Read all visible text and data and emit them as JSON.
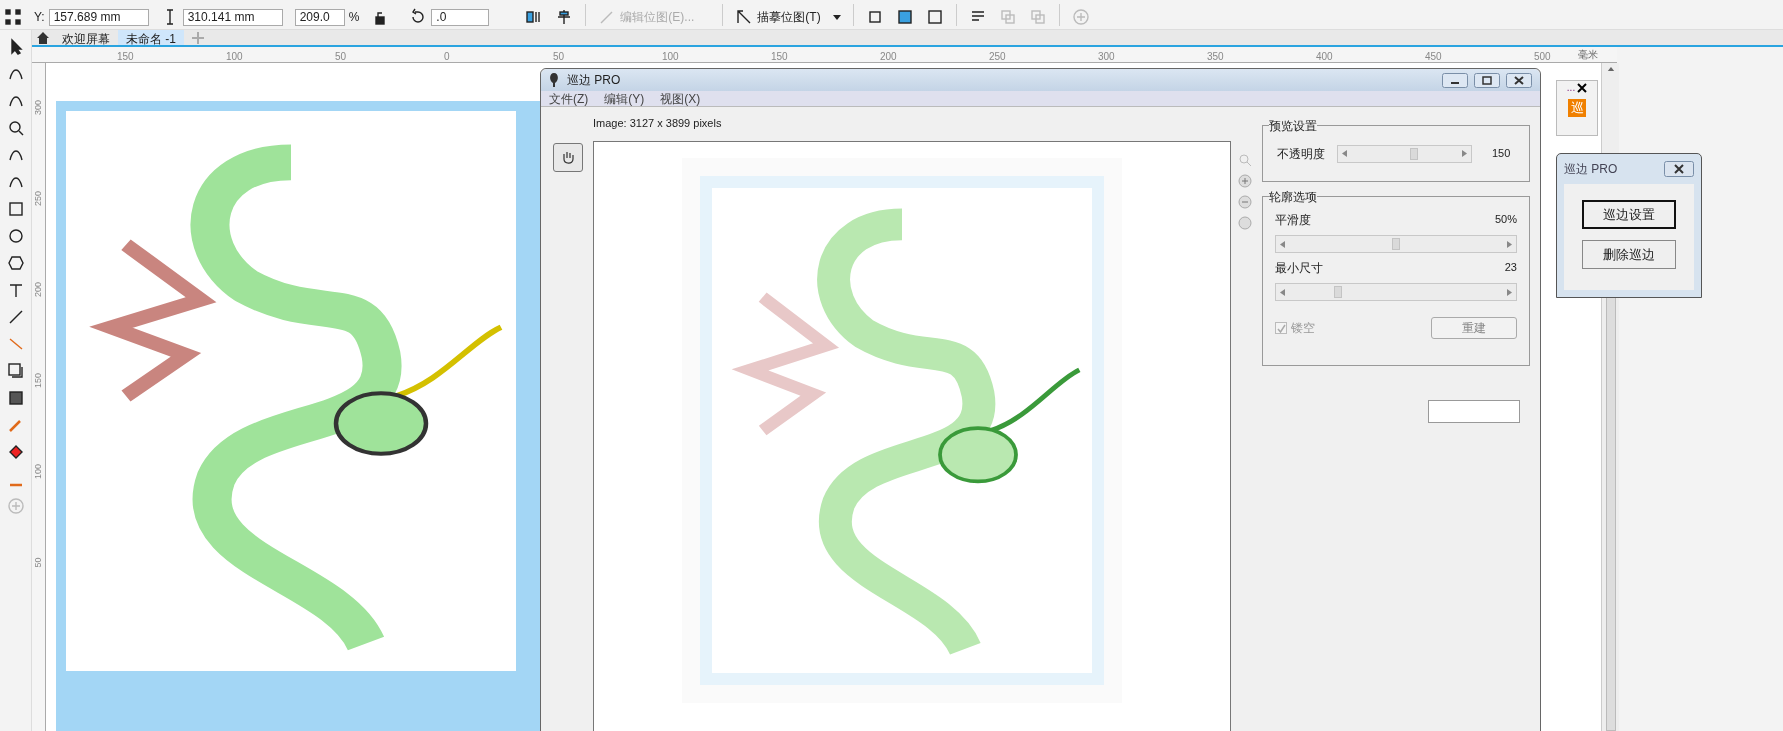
{
  "toolbar": {
    "y_label": "Y:",
    "y_value": "157.689 mm",
    "height_value": "310.141 mm",
    "scale_value": "209.0",
    "percent": "%",
    "angle_value": ".0",
    "edit_bitmap": "编辑位图(E)...",
    "trace_bitmap": "描摹位图(T)"
  },
  "doc_tabs": [
    {
      "label": "欢迎屏幕",
      "selected": false
    },
    {
      "label": "未命名 -1",
      "selected": true
    }
  ],
  "ruler": {
    "h_labels": [
      "150",
      "100",
      "50",
      "0",
      "50",
      "100",
      "150",
      "200",
      "250",
      "300",
      "350",
      "400",
      "450",
      "500"
    ],
    "unit": "毫米",
    "v_labels": [
      "300",
      "250",
      "200",
      "150",
      "100",
      "50"
    ]
  },
  "dialog": {
    "title": "巡边 PRO",
    "menu": [
      "文件(Z)",
      "编辑(Y)",
      "视图(X)"
    ],
    "image_info": "Image: 3127 x 3899 pixels",
    "preview_group": {
      "title": "预览设置",
      "label": "不透明度",
      "level": 0.59,
      "reading": "150"
    },
    "outline_group": {
      "title": "轮廓选项",
      "sliders": [
        {
          "label": "平滑度",
          "level": 0.5,
          "reading": "50%"
        },
        {
          "label": "最小尺寸",
          "level": 0.23,
          "reading": "23"
        }
      ],
      "hollow": {
        "label": "镂空",
        "checked": true,
        "disabled": true
      },
      "rebuild": "重建"
    }
  },
  "docker": {
    "more": "...",
    "icon_char": "巡"
  },
  "mini_dialog": {
    "title": "巡边 PRO",
    "buttons": [
      {
        "label": "巡边设置",
        "selected": true
      },
      {
        "label": "删除巡边",
        "selected": false
      }
    ]
  }
}
